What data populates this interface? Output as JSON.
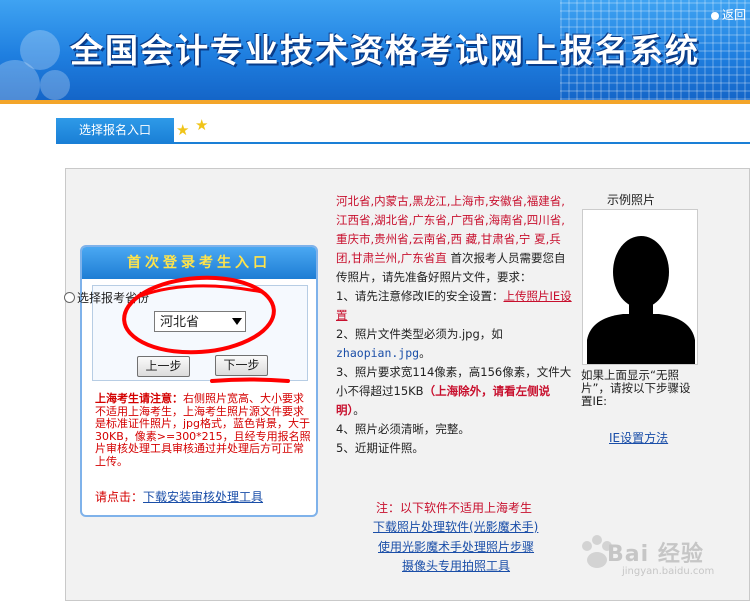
{
  "banner": {
    "title": "全国会计专业技术资格考试网上报名系统",
    "return_label": "返回"
  },
  "tab": {
    "label": "选择报名入口"
  },
  "login": {
    "header": "首次登录考生入口",
    "radio_label": "选择报考省份",
    "province_selected": "河北省",
    "prev_button": "上一步",
    "next_button": "下一步",
    "notice_title": "上海考生请注意：",
    "notice_body": "右侧照片宽高、大小要求不适用上海考生，上海考生照片源文件要求是标准证件照片，jpg格式，蓝色背景，大于30KB，像素>=300*215，且经专用报名照片审核处理工具审核通过并处理后方可正常上传。",
    "download_prefix": "请点击：",
    "download_link": "下载安装审核处理工具"
  },
  "info": {
    "provinces": "河北省,内蒙古,黑龙江,上海市,安徽省,福建省,江西省,湖北省,广东省,广西省,海南省,四川省,重庆市,贵州省,云南省,西 藏,甘肃省,宁 夏,兵 团,甘肃兰州,广东省直",
    "intro": "首次报考人员需要您自传照片，请先准备好照片文件，要求：",
    "item1_prefix": "1、请先注意修改IE的安全设置：",
    "item1_link": "上传照片IE设置",
    "item2_prefix": "2、照片文件类型必须为.jpg，如",
    "item2_example": "zhaopian.jpg",
    "item2_suffix": "。",
    "item3_text": "3、照片要求宽114像素，高156像素，文件大小不得超过15KB",
    "item3_bold": "（上海除外，请看左侧说明）",
    "item3_suffix": "。",
    "item4": "4、照片必须清晰，完整。",
    "item5": "5、近期证件照。"
  },
  "photo": {
    "label": "示例照片",
    "no_photo_note": "如果上面显示“无照片”，请按以下步骤设置IE:",
    "ie_link": "IE设置方法"
  },
  "bottom": {
    "note": "注：以下软件不适用上海考生",
    "link1": "下载照片处理软件(光影魔术手)",
    "link2": "使用光影魔术手处理照片步骤",
    "link3": "摄像头专用拍照工具"
  },
  "watermark": {
    "brand": "Bai 经验",
    "url": "jingyan.baidu.com"
  },
  "colors": {
    "banner_blue": "#1f7fe0",
    "accent_orange": "#f3a52a",
    "notice_red": "#d40000",
    "link_blue": "#1a4ea8",
    "annotation_red": "#ff0000"
  }
}
